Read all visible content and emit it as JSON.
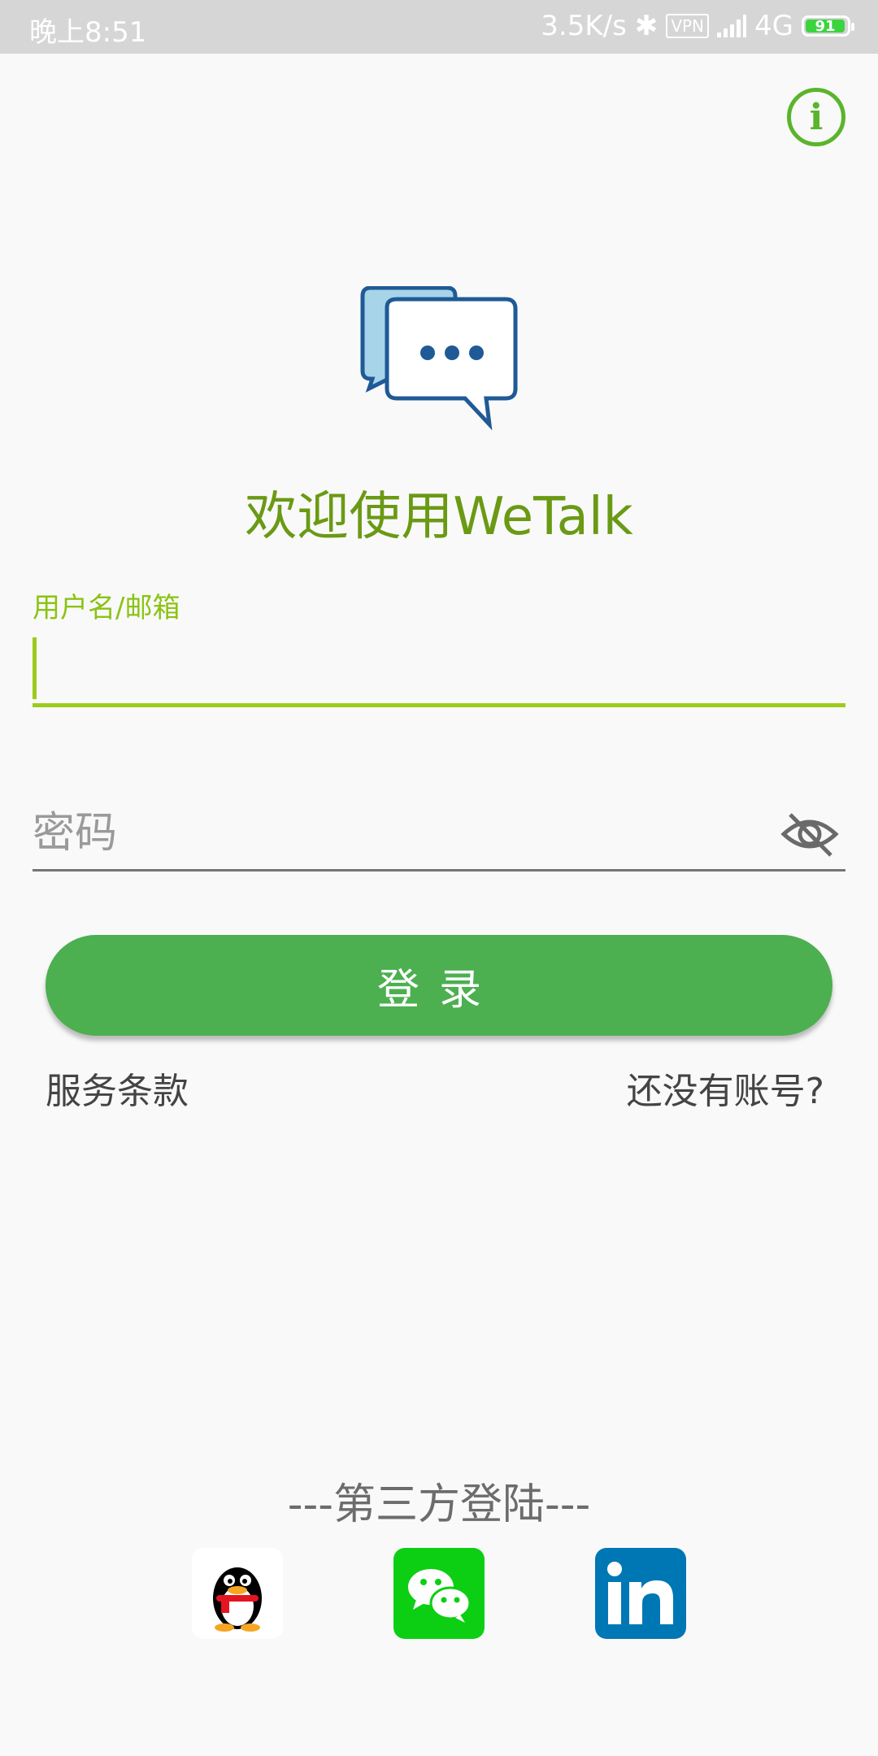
{
  "status_bar": {
    "time": "晚上8:51",
    "speed": "3.5K/s",
    "vpn": "VPN",
    "network": "4G",
    "battery": "91"
  },
  "header": {
    "info_icon": "info-icon"
  },
  "welcome": {
    "logo_icon": "chat-bubbles-icon",
    "title": "欢迎使用WeTalk"
  },
  "form": {
    "username_label": "用户名/邮箱",
    "username_value": "",
    "password_placeholder": "密码",
    "password_value": "",
    "visibility_icon": "eye-off-icon",
    "login_label": "登录",
    "terms_label": "服务条款",
    "register_label": "还没有账号?"
  },
  "third_party": {
    "title": "---第三方登陆---",
    "providers": [
      {
        "name": "qq-icon"
      },
      {
        "name": "wechat-icon"
      },
      {
        "name": "linkedin-icon"
      }
    ]
  },
  "colors": {
    "accent_green": "#4caf50",
    "title_green": "#6a9a14",
    "input_accent": "#9ccc1b"
  }
}
